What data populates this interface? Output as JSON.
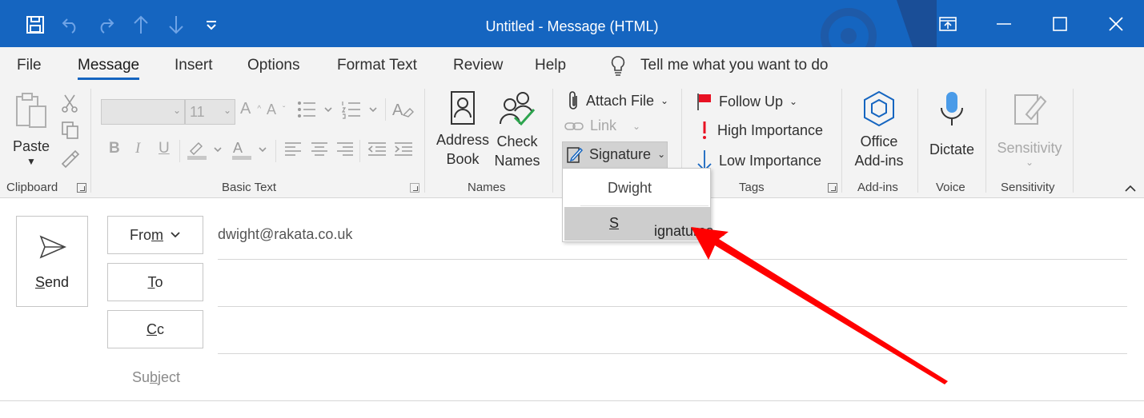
{
  "window": {
    "title": "Untitled  -  Message (HTML)"
  },
  "tabs": [
    {
      "label": "File"
    },
    {
      "label": "Message"
    },
    {
      "label": "Insert"
    },
    {
      "label": "Options"
    },
    {
      "label": "Format Text"
    },
    {
      "label": "Review"
    },
    {
      "label": "Help"
    }
  ],
  "tellme": {
    "label": "Tell me what you want to do"
  },
  "ribbon": {
    "clipboard": {
      "paste": "Paste",
      "group": "Clipboard"
    },
    "basic_text": {
      "font_size": "11",
      "group": "Basic Text"
    },
    "names": {
      "address_book_1": "Address",
      "address_book_2": "Book",
      "check_names_1": "Check",
      "check_names_2": "Names",
      "group": "Names"
    },
    "include": {
      "attach_file": "Attach File",
      "link": "Link",
      "signature": "Signature"
    },
    "tags": {
      "follow_up": "Follow Up",
      "high": "High Importance",
      "low": "Low Importance",
      "group": "Tags"
    },
    "addins": {
      "office_1": "Office",
      "office_2": "Add-ins",
      "group": "Add-ins"
    },
    "voice": {
      "dictate": "Dictate",
      "group": "Voice"
    },
    "sensitivity": {
      "button": "Sensitivity",
      "group": "Sensitivity"
    }
  },
  "signature_menu": {
    "items": [
      {
        "label": "Dwight"
      },
      {
        "label_pre": "",
        "label_ul": "S",
        "label_post": "ignatures..."
      }
    ]
  },
  "compose": {
    "send_pre": "",
    "send_ul": "S",
    "send_post": "end",
    "from_pre": "Fro",
    "from_ul": "m",
    "from_post": "",
    "to_ul": "T",
    "to_post": "o",
    "cc_ul": "C",
    "cc_post": "c",
    "from_address": "dwight@rakata.co.uk",
    "subject_pre": "Su",
    "subject_ul": "b",
    "subject_post": "ject"
  },
  "colors": {
    "titlebar": "#1565c0",
    "accent": "#1565c0",
    "ribbon_bg": "#f3f3f3",
    "annotation_arrow": "#ff0000",
    "high_importance": "#e81123",
    "follow_up_flag": "#e81123",
    "check_names": "#2da44e"
  }
}
